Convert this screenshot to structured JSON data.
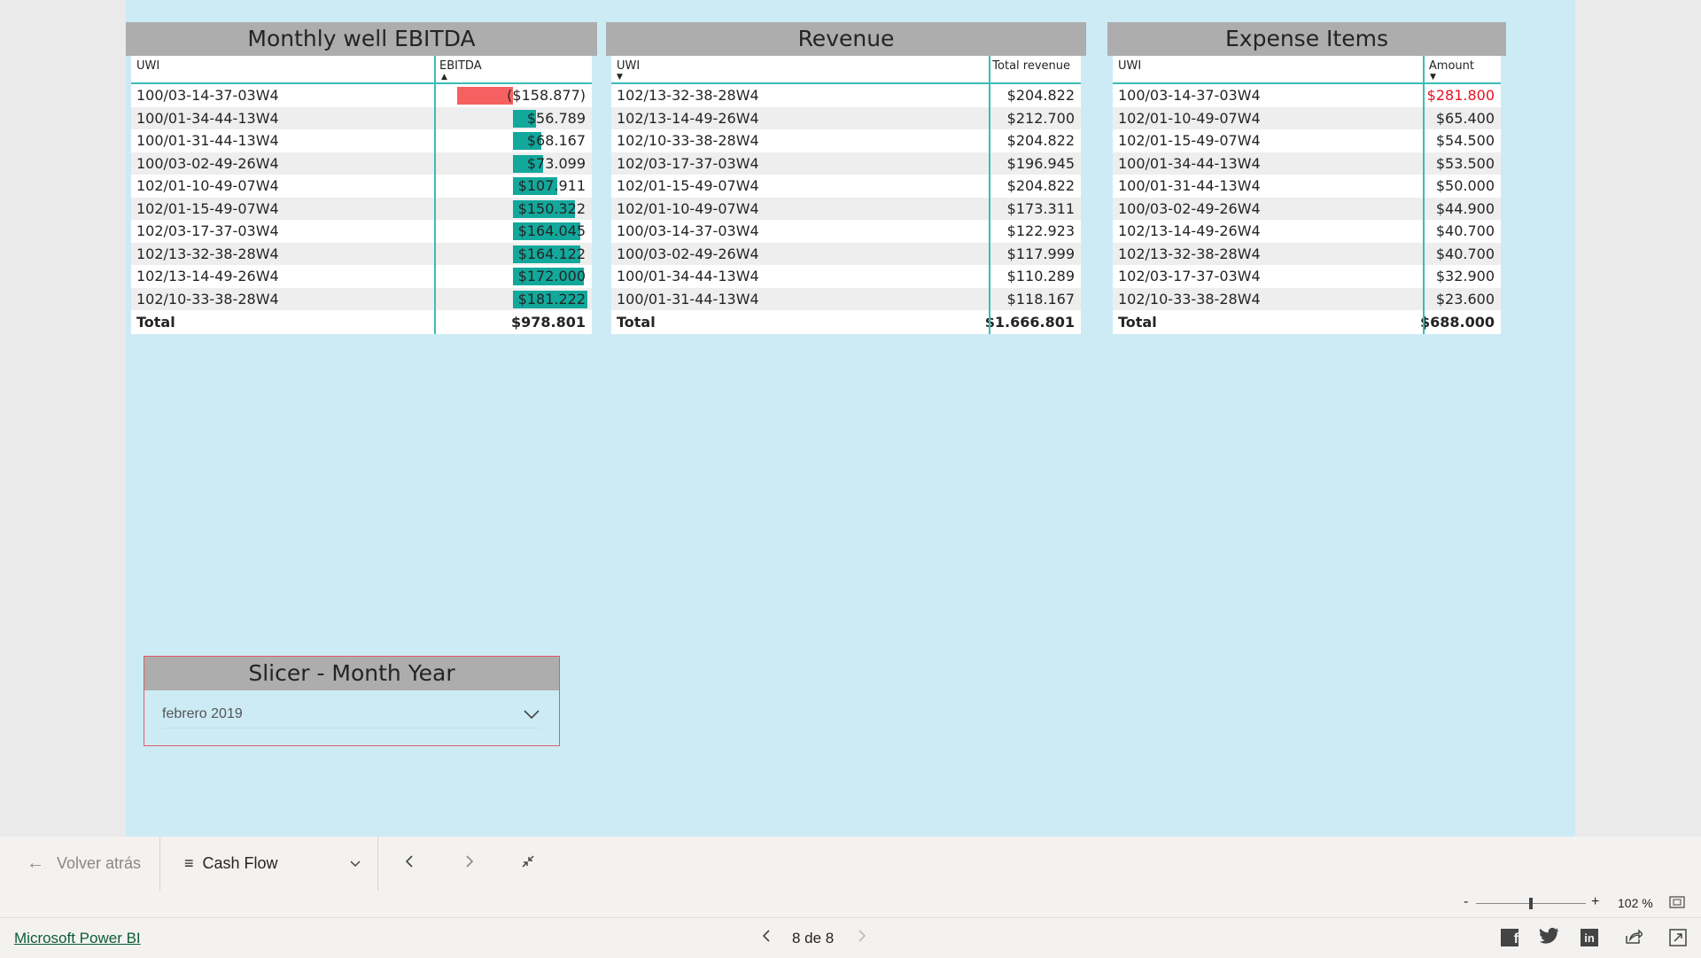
{
  "ebitda": {
    "title": "Monthly well EBITDA",
    "col_uwi": "UWI",
    "col_value": "EBITDA",
    "rows": [
      {
        "uwi": "100/03-14-37-03W4",
        "value": "($158.877)",
        "num": -158877
      },
      {
        "uwi": "100/01-34-44-13W4",
        "value": "$56.789",
        "num": 56789
      },
      {
        "uwi": "100/01-31-44-13W4",
        "value": "$68.167",
        "num": 68167
      },
      {
        "uwi": "100/03-02-49-26W4",
        "value": "$73.099",
        "num": 73099
      },
      {
        "uwi": "102/01-10-49-07W4",
        "value": "$107.911",
        "num": 107911
      },
      {
        "uwi": "102/01-15-49-07W4",
        "value": "$150.322",
        "num": 150322
      },
      {
        "uwi": "102/03-17-37-03W4",
        "value": "$164.045",
        "num": 164045
      },
      {
        "uwi": "102/13-32-38-28W4",
        "value": "$164.122",
        "num": 164122
      },
      {
        "uwi": "102/13-14-49-26W4",
        "value": "$172.000",
        "num": 172000
      },
      {
        "uwi": "102/10-33-38-28W4",
        "value": "$181.222",
        "num": 181222
      }
    ],
    "total_label": "Total",
    "total_value": "$978.801",
    "pos_color": "#12a89c",
    "neg_color": "#f76060"
  },
  "revenue": {
    "title": "Revenue",
    "col_uwi": "UWI",
    "col_value": "Total revenue",
    "rows": [
      {
        "uwi": "102/13-32-38-28W4",
        "value": "$204.822"
      },
      {
        "uwi": "102/13-14-49-26W4",
        "value": "$212.700"
      },
      {
        "uwi": "102/10-33-38-28W4",
        "value": "$204.822"
      },
      {
        "uwi": "102/03-17-37-03W4",
        "value": "$196.945"
      },
      {
        "uwi": "102/01-15-49-07W4",
        "value": "$204.822"
      },
      {
        "uwi": "102/01-10-49-07W4",
        "value": "$173.311"
      },
      {
        "uwi": "100/03-14-37-03W4",
        "value": "$122.923"
      },
      {
        "uwi": "100/03-02-49-26W4",
        "value": "$117.999"
      },
      {
        "uwi": "100/01-34-44-13W4",
        "value": "$110.289"
      },
      {
        "uwi": "100/01-31-44-13W4",
        "value": "$118.167"
      }
    ],
    "total_label": "Total",
    "total_value": "$1.666.801"
  },
  "expense": {
    "title": "Expense Items",
    "col_uwi": "UWI",
    "col_value": "Amount",
    "rows": [
      {
        "uwi": "100/03-14-37-03W4",
        "value": "$281.800",
        "highlight": true
      },
      {
        "uwi": "102/01-10-49-07W4",
        "value": "$65.400"
      },
      {
        "uwi": "102/01-15-49-07W4",
        "value": "$54.500"
      },
      {
        "uwi": "100/01-34-44-13W4",
        "value": "$53.500"
      },
      {
        "uwi": "100/01-31-44-13W4",
        "value": "$50.000"
      },
      {
        "uwi": "100/03-02-49-26W4",
        "value": "$44.900"
      },
      {
        "uwi": "102/13-14-49-26W4",
        "value": "$40.700"
      },
      {
        "uwi": "102/13-32-38-28W4",
        "value": "$40.700"
      },
      {
        "uwi": "102/03-17-37-03W4",
        "value": "$32.900"
      },
      {
        "uwi": "102/10-33-38-28W4",
        "value": "$23.600"
      }
    ],
    "total_label": "Total",
    "total_value": "$688.000",
    "highlight_color": "#e81123"
  },
  "slicer": {
    "title": "Slicer - Month Year",
    "selected": "febrero 2019"
  },
  "nav": {
    "back_label": "Volver atrás",
    "page_name": "Cash Flow"
  },
  "zoom": {
    "minus": "-",
    "plus": "+",
    "level": "102 %",
    "slider_fraction": 0.5
  },
  "footer": {
    "brand": "Microsoft Power BI",
    "page_indicator": "8 de 8"
  }
}
